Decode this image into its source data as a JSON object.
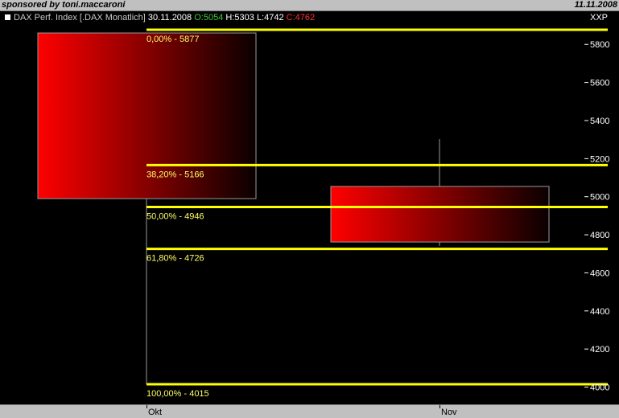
{
  "header": {
    "sponsor": "sponsored by toni.maccaroni",
    "date": "11.11.2008"
  },
  "legend": {
    "name": "DAX Perf. Index [.DAX  Monatlich]",
    "date": "30.11.2008",
    "open": "O:5054",
    "high": "H:5303",
    "low": "L:4742",
    "close": "C:4762"
  },
  "y_unit": "XXP",
  "colors": {
    "fib_line": "#ffff00",
    "fib_label": "#ffff66",
    "candle_bear": "#ff0000",
    "background": "#000000",
    "axis_text": "#ffffff"
  },
  "chart_data": {
    "type": "candlestick",
    "ylim": [
      3950,
      5880
    ],
    "y_ticks": [
      4000,
      4200,
      4400,
      4600,
      4800,
      5000,
      5200,
      5400,
      5600,
      5800
    ],
    "y_tick_labels": [
      "4000",
      "4200",
      "4400",
      "4600",
      "4800",
      "5000",
      "5200",
      "5400",
      "5600",
      "5800"
    ],
    "x_tick_labels": [
      "Okt",
      "Nov"
    ],
    "candles": [
      {
        "period": "Okt",
        "open": 5860,
        "high": 5860,
        "low": 4015,
        "close": 4990
      },
      {
        "period": "Nov",
        "open": 5054,
        "high": 5303,
        "low": 4742,
        "close": 4762
      }
    ],
    "fib_levels": [
      {
        "value": 5877,
        "label": "0,00% - 5877"
      },
      {
        "value": 5166,
        "label": "38,20% - 5166"
      },
      {
        "value": 4946,
        "label": "50,00% - 4946"
      },
      {
        "value": 4726,
        "label": "61,80% - 4726"
      },
      {
        "value": 4015,
        "label": "100,00% - 4015"
      }
    ]
  }
}
